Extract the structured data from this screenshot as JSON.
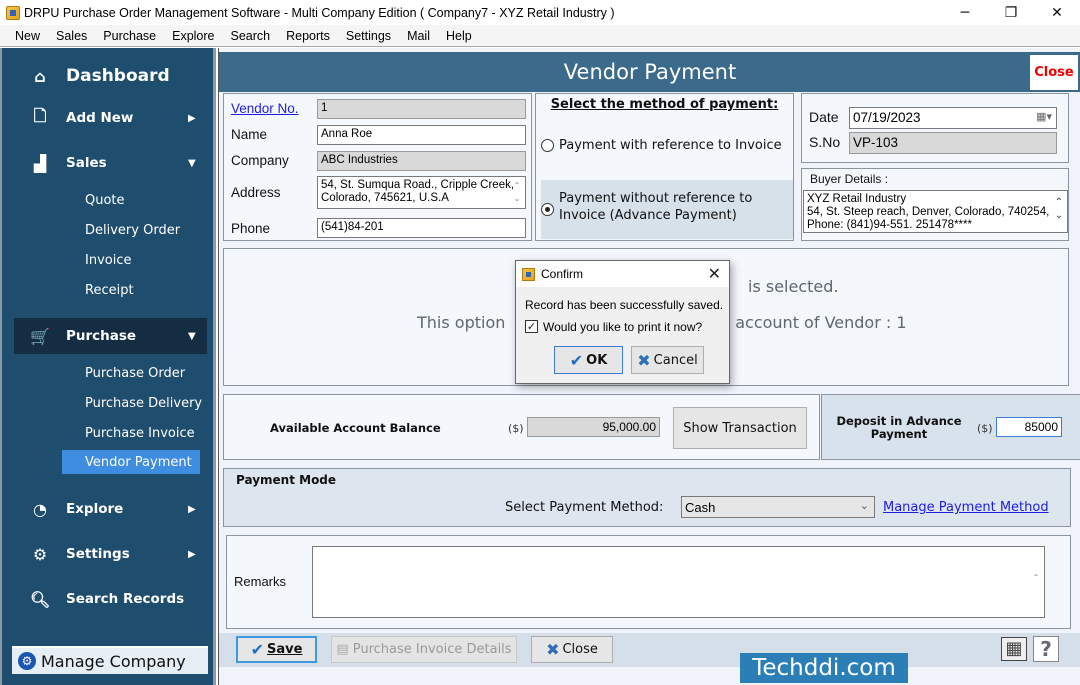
{
  "window": {
    "title": "DRPU Purchase Order Management Software - Multi Company Edition ( Company7 - XYZ Retail Industry )",
    "minimize": "─",
    "restore": "❐",
    "close": "✕"
  },
  "menu": [
    "New",
    "Sales",
    "Purchase",
    "Explore",
    "Search",
    "Reports",
    "Settings",
    "Mail",
    "Help"
  ],
  "sidebar": {
    "dashboard": "Dashboard",
    "add_new": "Add New",
    "sales": "Sales",
    "sales_items": [
      "Quote",
      "Delivery Order",
      "Invoice",
      "Receipt"
    ],
    "purchase": "Purchase",
    "purchase_items": [
      "Purchase Order",
      "Purchase Delivery",
      "Purchase Invoice",
      "Vendor Payment"
    ],
    "selected_item": "Vendor Payment",
    "explore": "Explore",
    "settings": "Settings",
    "search_records": "Search Records",
    "manage_company": "Manage Company"
  },
  "page": {
    "title": "Vendor Payment",
    "close_label": "Close"
  },
  "vendor": {
    "vendor_no_label": "Vendor No.",
    "vendor_no": "1",
    "name_label": "Name",
    "name": "Anna Roe",
    "company_label": "Company",
    "company": "ABC Industries",
    "address_label": "Address",
    "address_line1": "54, St. Sumqua Road., Cripple Creek,",
    "address_line2": "Colorado, 745621, U.S.A",
    "phone_label": "Phone",
    "phone": "(541)84-201"
  },
  "payment_method": {
    "heading": "Select the method of payment:",
    "option1": "Payment with reference to Invoice",
    "option2_line1": "Payment without reference to",
    "option2_line2": "Invoice (Advance Payment)",
    "selected": "option2"
  },
  "meta": {
    "date_label": "Date",
    "date": "07/19/2023",
    "sno_label": "S.No",
    "sno": "VP-103",
    "buyer_label": "Buyer Details :",
    "buyer_line1": "XYZ Retail Industry",
    "buyer_line2": "54, St. Steep reach, Denver, Colorado, 740254,",
    "buyer_line3": "Phone: (841)94-551. 251478****"
  },
  "info": {
    "line1_visible": "is selected.",
    "line2_left": "This option",
    "line2_right": "n account of Vendor : 1"
  },
  "balance": {
    "label": "Available Account Balance",
    "currency": "($)",
    "value": "95,000.00",
    "show_transaction": "Show Transaction",
    "deposit_label_line1": "Deposit in Advance",
    "deposit_label_line2": "Payment",
    "deposit_currency": "($)",
    "deposit_value": "85000"
  },
  "payment_mode": {
    "heading": "Payment Mode",
    "select_label": "Select Payment Method:",
    "selected_method": "Cash",
    "manage_link": "Manage Payment Method"
  },
  "remarks": {
    "label": "Remarks",
    "value": ""
  },
  "footer": {
    "save": "Save",
    "purchase_invoice_details": "Purchase Invoice Details",
    "close": "Close"
  },
  "dialog": {
    "title": "Confirm",
    "message": "Record has been successfully saved.",
    "checkbox_label": "Would you like to print it now?",
    "checkbox_checked": true,
    "ok": "OK",
    "cancel": "Cancel"
  },
  "watermark": "Techddi.com"
}
